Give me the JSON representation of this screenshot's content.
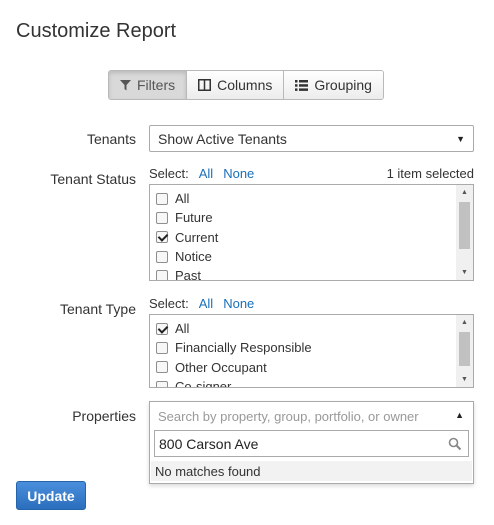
{
  "page": {
    "title": "Customize Report"
  },
  "tabs": [
    {
      "label": "Filters",
      "icon": "filter-icon",
      "active": true
    },
    {
      "label": "Columns",
      "icon": "columns-icon",
      "active": false
    },
    {
      "label": "Grouping",
      "icon": "list-icon",
      "active": false
    }
  ],
  "tenants": {
    "label": "Tenants",
    "value": "Show Active Tenants"
  },
  "tenant_status": {
    "label": "Tenant Status",
    "select_label": "Select:",
    "all_link": "All",
    "none_link": "None",
    "count_text": "1 item selected",
    "options": [
      {
        "label": "All",
        "checked": false
      },
      {
        "label": "Future",
        "checked": false
      },
      {
        "label": "Current",
        "checked": true
      },
      {
        "label": "Notice",
        "checked": false
      },
      {
        "label": "Past",
        "checked": false
      }
    ]
  },
  "tenant_type": {
    "label": "Tenant Type",
    "select_label": "Select:",
    "all_link": "All",
    "none_link": "None",
    "options": [
      {
        "label": "All",
        "checked": true
      },
      {
        "label": "Financially Responsible",
        "checked": false
      },
      {
        "label": "Other Occupant",
        "checked": false
      },
      {
        "label": "Co-signer",
        "checked": false
      }
    ]
  },
  "properties": {
    "label": "Properties",
    "placeholder": "Search by property, group, portfolio, or owner",
    "search_value": "800 Carson Ave",
    "no_results": "No matches found"
  },
  "update_button": "Update",
  "colors": {
    "accent": "#1a6fb8",
    "button": "#2a6ebd"
  }
}
